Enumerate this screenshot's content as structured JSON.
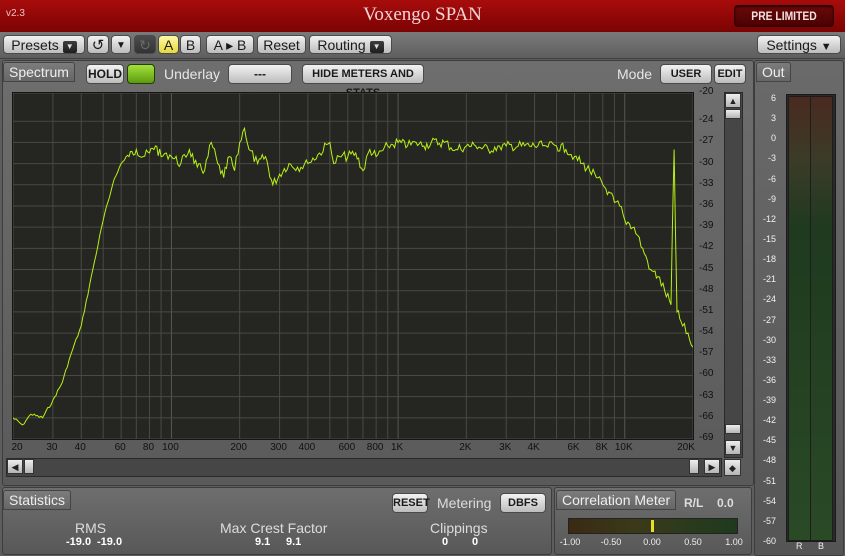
{
  "app": {
    "version": "v2.3",
    "title": "Voxengo SPAN",
    "preset_chip": "PRE LIMITED"
  },
  "toolbar": {
    "presets": "Presets",
    "a": "A",
    "b": "B",
    "a_to_b": "A ▸ B",
    "reset": "Reset",
    "routing": "Routing",
    "settings": "Settings"
  },
  "spectrum": {
    "tab": "Spectrum",
    "hold": "HOLD",
    "underlay_label": "Underlay",
    "underlay_value": "---",
    "hide_meters": "HIDE METERS AND STATS",
    "mode_label": "Mode",
    "mode_user": "USER",
    "mode_edit": "EDIT",
    "y_ticks": [
      "-20",
      "-24",
      "-27",
      "-30",
      "-33",
      "-36",
      "-39",
      "-42",
      "-45",
      "-48",
      "-51",
      "-54",
      "-57",
      "-60",
      "-63",
      "-66",
      "-69"
    ],
    "x_ticks": [
      "20",
      "30",
      "40",
      "60",
      "80",
      "100",
      "200",
      "300",
      "400",
      "600",
      "800",
      "1K",
      "2K",
      "3K",
      "4K",
      "6K",
      "8K",
      "10K",
      "20K"
    ]
  },
  "chart_data": {
    "type": "line",
    "xlabel": "",
    "ylabel": "",
    "x_scale": "log",
    "xlim": [
      20,
      20000
    ],
    "ylim": [
      -69,
      -20
    ],
    "grid": true,
    "color": "#b6f214",
    "series": [
      {
        "x": [
          20,
          22,
          24,
          27,
          30,
          33,
          36,
          40,
          45,
          50,
          55,
          60,
          65,
          70,
          75,
          80,
          85,
          90,
          95,
          100,
          110,
          120,
          130,
          140,
          150,
          160,
          170,
          180,
          190,
          200,
          210,
          220,
          240,
          260,
          280,
          300,
          330,
          360,
          400,
          450,
          500,
          520,
          550,
          600,
          650,
          700,
          750,
          800,
          900,
          1000,
          1100,
          1200,
          1300,
          1400,
          1600,
          1800,
          2000,
          2200,
          2500,
          2800,
          3000,
          3500,
          4000,
          4500,
          5000,
          5500,
          6000,
          6500,
          7000,
          7500,
          8000,
          8500,
          9000,
          9500,
          10000,
          11000,
          12000,
          13000,
          14000,
          15000,
          16000,
          16500,
          17000,
          18000,
          19000,
          20000
        ],
        "y": [
          -66,
          -67,
          -65.5,
          -66,
          -63.5,
          -61,
          -57,
          -53,
          -45,
          -38,
          -33,
          -30,
          -29,
          -28,
          -29,
          -28.5,
          -27.5,
          -29,
          -28.5,
          -29,
          -30,
          -28,
          -30.5,
          -31,
          -27,
          -30,
          -32,
          -29,
          -31,
          -27,
          -25,
          -28,
          -30,
          -29,
          -33,
          -31.5,
          -30,
          -30.5,
          -30,
          -28.5,
          -27,
          -30,
          -29,
          -29,
          -28.5,
          -31,
          -28,
          -29,
          -27.5,
          -27,
          -27.5,
          -27,
          -27.5,
          -27,
          -27,
          -28,
          -27.5,
          -27.5,
          -28,
          -27.5,
          -27.5,
          -27.5,
          -27.5,
          -27.5,
          -27.5,
          -28,
          -29,
          -30,
          -31,
          -32,
          -33,
          -34,
          -35.5,
          -36,
          -38,
          -39,
          -42,
          -45,
          -46,
          -48,
          -50,
          -28,
          -51,
          -53,
          -54,
          -56
        ]
      }
    ]
  },
  "stats": {
    "tab": "Statistics",
    "reset": "RESET",
    "metering_label": "Metering",
    "metering_value": "DBFS",
    "rms_label": "RMS",
    "rms_l": "-19.0",
    "rms_r": "-19.0",
    "crest_label": "Max Crest Factor",
    "crest_l": "9.1",
    "crest_r": "9.1",
    "clip_label": "Clippings",
    "clip_l": "0",
    "clip_r": "0"
  },
  "correlation": {
    "tab": "Correlation Meter",
    "rl_label": "R/L",
    "rl_value": "0.0",
    "ticks": [
      "-1.00",
      "-0.50",
      "0.00",
      "0.50",
      "1.00"
    ],
    "value": 0.0
  },
  "out": {
    "tab": "Out",
    "ticks": [
      "6",
      "3",
      "0",
      "-3",
      "-6",
      "-9",
      "-12",
      "-15",
      "-18",
      "-21",
      "-24",
      "-27",
      "-30",
      "-33",
      "-36",
      "-39",
      "-42",
      "-45",
      "-48",
      "-51",
      "-54",
      "-57",
      "-60"
    ],
    "ch_r": "R",
    "ch_b": "B"
  }
}
